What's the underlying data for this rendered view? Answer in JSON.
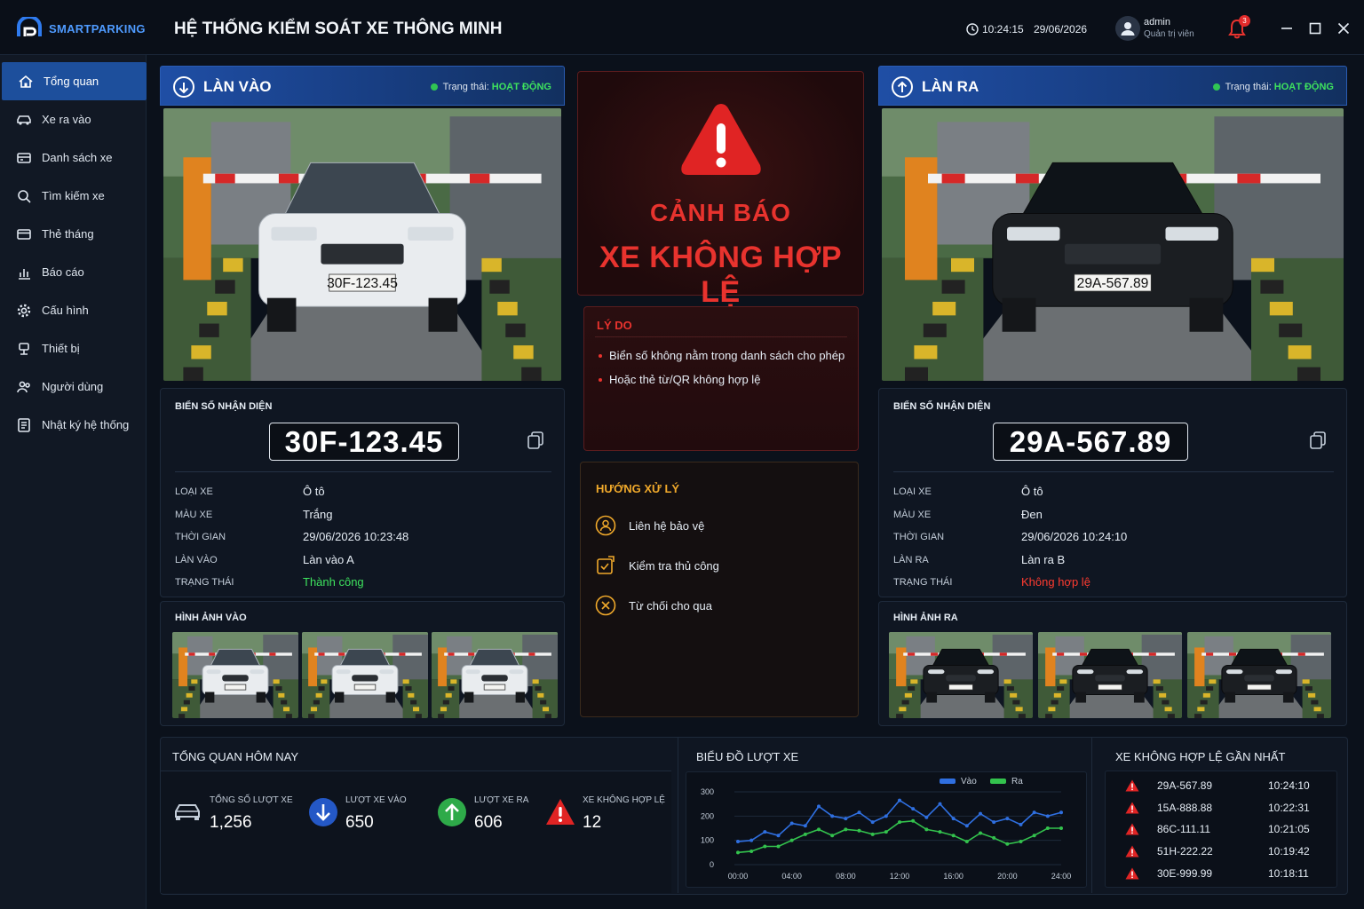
{
  "app": {
    "logo_text": "SMARTPARKING",
    "title": "HỆ THỐNG KIỂM SOÁT XE THÔNG MINH",
    "time": "10:24:15",
    "date": "29/06/2026",
    "user_name": "admin",
    "user_role": "Quản trị viên",
    "notifications": "3"
  },
  "sidebar": {
    "items": [
      {
        "label": "Tổng quan",
        "icon": "home-icon",
        "active": true
      },
      {
        "label": "Xe ra vào",
        "icon": "car-icon"
      },
      {
        "label": "Danh sách xe",
        "icon": "car-list-icon"
      },
      {
        "label": "Tìm kiếm xe",
        "icon": "search-icon"
      },
      {
        "label": "Thẻ tháng",
        "icon": "card-icon"
      },
      {
        "label": "Báo cáo",
        "icon": "bar-chart-icon"
      },
      {
        "label": "Cấu hình",
        "icon": "gear-icon"
      },
      {
        "label": "Thiết bị",
        "icon": "device-icon"
      },
      {
        "label": "Người dùng",
        "icon": "users-icon"
      },
      {
        "label": "Nhật ký hệ thống",
        "icon": "log-icon"
      }
    ]
  },
  "lane_in": {
    "title": "LÀN VÀO",
    "status_label": "Trạng thái:",
    "status_value": "HOẠT ĐỘNG",
    "plate_label": "BIỂN SỐ NHẬN DIỆN",
    "plate": "30F-123.45",
    "camera_plate": "30F-123.45",
    "fields": [
      {
        "label": "LOẠI XE",
        "value": "Ô tô"
      },
      {
        "label": "MÀU XE",
        "value": "Trắng"
      },
      {
        "label": "THỜI GIAN",
        "value": "29/06/2026 10:23:48"
      },
      {
        "label": "LÀN VÀO",
        "value": "Làn vào A"
      },
      {
        "label": "TRẠNG THÁI",
        "value": "Thành công",
        "color": "#3ee35e"
      }
    ],
    "images_label": "HÌNH ẢNH VÀO",
    "car_color": "#e9ecef"
  },
  "lane_out": {
    "title": "LÀN RA",
    "status_label": "Trạng thái:",
    "status_value": "HOẠT ĐỘNG",
    "plate_label": "BIỂN SỐ NHẬN DIỆN",
    "plate": "29A-567.89",
    "camera_plate": "29A-567.89",
    "fields": [
      {
        "label": "LOẠI XE",
        "value": "Ô tô"
      },
      {
        "label": "MÀU XE",
        "value": "Đen"
      },
      {
        "label": "THỜI GIAN",
        "value": "29/06/2026 10:24:10"
      },
      {
        "label": "LÀN RA",
        "value": "Làn ra B"
      },
      {
        "label": "TRẠNG THÁI",
        "value": "Không hợp lệ",
        "color": "#ff3b30"
      }
    ],
    "images_label": "HÌNH ẢNH RA",
    "car_color": "#1b1e22"
  },
  "alert": {
    "line1": "CẢNH BÁO",
    "line2": "XE KHÔNG HỢP LỆ",
    "reason_title": "LÝ DO",
    "reasons": [
      "Biển số không nằm trong danh sách cho phép",
      "Hoặc thẻ từ/QR không hợp lệ"
    ],
    "handle_title": "HƯỚNG XỬ LÝ",
    "actions": [
      {
        "label": "Liên hệ bảo vệ",
        "icon": "guard-icon"
      },
      {
        "label": "Kiểm tra thủ công",
        "icon": "manual-check-icon"
      },
      {
        "label": "Từ chối cho qua",
        "icon": "reject-icon"
      }
    ]
  },
  "summary": {
    "title": "TỔNG QUAN HÔM NAY",
    "stats": [
      {
        "label": "TỔNG SỐ LƯỢT XE",
        "value": "1,256",
        "icon": "car-icon"
      },
      {
        "label": "LƯỢT XE VÀO",
        "value": "650",
        "icon": "arrow-down-icon"
      },
      {
        "label": "LƯỢT XE RA",
        "value": "606",
        "icon": "arrow-up-icon"
      },
      {
        "label": "XE KHÔNG HỢP LỆ",
        "value": "12",
        "icon": "warning-icon"
      }
    ]
  },
  "chart_data": {
    "type": "line",
    "title": "BIỂU ĐỒ LƯỢT XE",
    "x_ticks": [
      "00:00",
      "04:00",
      "08:00",
      "12:00",
      "16:00",
      "20:00",
      "24:00"
    ],
    "y_ticks": [
      0,
      100,
      200,
      300
    ],
    "ylim": [
      0,
      300
    ],
    "xlim": [
      0,
      24
    ],
    "legend_position": "top-right",
    "series": [
      {
        "name": "Vào",
        "color": "#2f6fe0",
        "x": [
          0,
          1,
          2,
          3,
          4,
          5,
          6,
          7,
          8,
          9,
          10,
          11,
          12,
          13,
          14,
          15,
          16,
          17,
          18,
          19,
          20,
          21,
          22,
          23,
          24
        ],
        "values": [
          95,
          100,
          135,
          120,
          170,
          160,
          240,
          200,
          190,
          215,
          175,
          200,
          265,
          230,
          195,
          250,
          190,
          160,
          210,
          175,
          190,
          165,
          215,
          200,
          215
        ]
      },
      {
        "name": "Ra",
        "color": "#33c24d",
        "x": [
          0,
          1,
          2,
          3,
          4,
          5,
          6,
          7,
          8,
          9,
          10,
          11,
          12,
          13,
          14,
          15,
          16,
          17,
          18,
          19,
          20,
          21,
          22,
          23,
          24
        ],
        "values": [
          50,
          55,
          75,
          75,
          100,
          125,
          145,
          120,
          145,
          140,
          125,
          135,
          175,
          180,
          145,
          135,
          120,
          95,
          130,
          110,
          85,
          95,
          120,
          150,
          150
        ]
      }
    ]
  },
  "violations": {
    "title": "XE KHÔNG HỢP LỆ GẦN NHẤT",
    "rows": [
      {
        "plate": "29A-567.89",
        "time": "10:24:10"
      },
      {
        "plate": "15A-888.88",
        "time": "10:22:31"
      },
      {
        "plate": "86C-111.11",
        "time": "10:21:05"
      },
      {
        "plate": "51H-222.22",
        "time": "10:19:42"
      },
      {
        "plate": "30E-999.99",
        "time": "10:18:11"
      }
    ]
  }
}
